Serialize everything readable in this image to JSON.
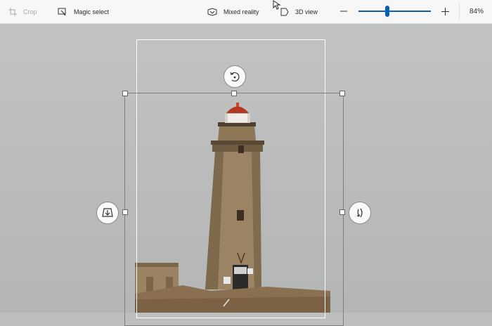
{
  "toolbar": {
    "crop_label": "Crop",
    "magic_select_label": "Magic select",
    "mixed_reality_label": "Mixed reality",
    "view_3d_label": "3D view",
    "zoom_percent": "84%",
    "zoom_level": 0.4
  },
  "icons": {
    "crop": "crop-icon",
    "magic_select": "magic-select-icon",
    "mixed_reality": "mixed-reality-icon",
    "view_3d": "3d-view-icon",
    "zoom_out": "minus-icon",
    "zoom_in": "plus-icon",
    "rotate_z": "rotate-icon",
    "rotate_x": "tilt-icon",
    "rotate_y": "turn-icon",
    "cursor": "cursor-icon"
  },
  "colors": {
    "accent": "#0a5fb0",
    "toolbar_bg": "#f7f7f7",
    "canvas_bg": "#bdbfbf"
  }
}
